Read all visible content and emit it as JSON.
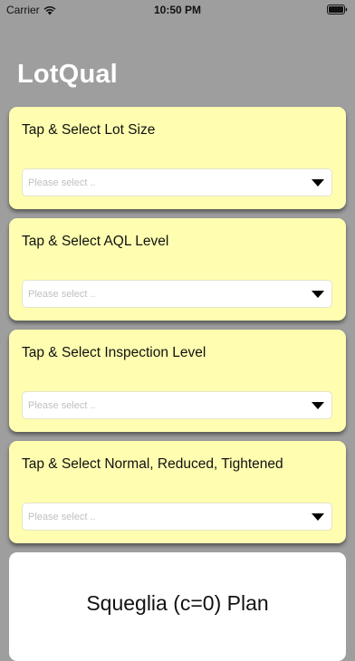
{
  "status_bar": {
    "carrier": "Carrier",
    "time": "10:50 PM"
  },
  "app": {
    "title": "LotQual"
  },
  "cards": [
    {
      "title": "Tap & Select Lot Size",
      "placeholder": "Please select .."
    },
    {
      "title": "Tap & Select AQL Level",
      "placeholder": "Please select .."
    },
    {
      "title": "Tap & Select Inspection Level",
      "placeholder": "Please select .."
    },
    {
      "title": "Tap & Select Normal, Reduced, Tightened",
      "placeholder": "Please select .."
    }
  ],
  "plan": {
    "title": "Squeglia (c=0) Plan"
  },
  "colors": {
    "background": "#9e9e9e",
    "card": "#fffeb0",
    "title": "#ffffff"
  }
}
